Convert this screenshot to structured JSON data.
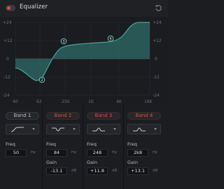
{
  "header": {
    "title": "Equalizer",
    "enabled": true,
    "icons": {
      "toggle": "power-toggle",
      "reset": "reset-icon"
    }
  },
  "graph": {
    "y_labels": [
      "+24",
      "+12",
      "0",
      "-12",
      "-24"
    ],
    "x_labels": [
      "40",
      "62",
      "250",
      "1K",
      "4K",
      "16K"
    ],
    "curve_color": "#4aa39a",
    "fill_color": "#2e6b67",
    "nodes": [
      {
        "label": "1"
      },
      {
        "label": "2"
      },
      {
        "label": "3"
      },
      {
        "label": "4"
      }
    ]
  },
  "bands": [
    {
      "label": "Band 1",
      "active": false,
      "shape_icon": "low-cut-icon",
      "freq_label": "Freq",
      "freq": "50",
      "freq_unit": "Hz"
    },
    {
      "label": "Band 2",
      "active": true,
      "shape_icon": "bell-icon",
      "freq_label": "Freq",
      "freq": "84",
      "freq_unit": "Hz",
      "gain_label": "Gain",
      "gain": "-13.1",
      "gain_unit": "dB"
    },
    {
      "label": "Band 3",
      "active": true,
      "shape_icon": "bell-icon",
      "freq_label": "Freq",
      "freq": "248",
      "freq_unit": "Hz",
      "gain_label": "Gain",
      "gain": "+11.8",
      "gain_unit": "dB"
    },
    {
      "label": "Band 4",
      "active": true,
      "shape_icon": "bell-icon",
      "freq_label": "Freq",
      "freq": "2k8",
      "freq_unit": "Hz",
      "gain_label": "Gain",
      "gain": "+13.1",
      "gain_unit": "dB"
    }
  ]
}
